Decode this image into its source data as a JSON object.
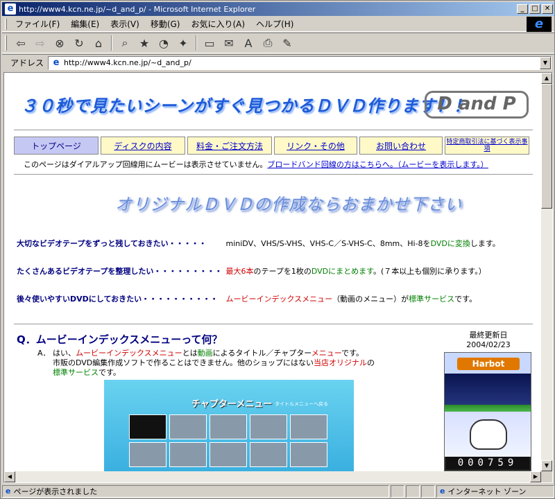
{
  "window": {
    "title": "http://www4.kcn.ne.jp/~d_and_p/ - Microsoft Internet Explorer"
  },
  "menu": [
    "ファイル(F)",
    "編集(E)",
    "表示(V)",
    "移動(G)",
    "お気に入り(A)",
    "ヘルプ(H)"
  ],
  "toolbar": {
    "icons": [
      "back-icon",
      "forward-icon",
      "stop-icon",
      "refresh-icon",
      "home-icon",
      "search-icon",
      "favorites-icon",
      "history-icon",
      "channels-icon",
      "fullscreen-icon",
      "mail-icon",
      "font-icon",
      "print-icon",
      "edit-icon"
    ]
  },
  "address": {
    "label": "アドレス",
    "url": "http://www4.kcn.ne.jp/~d_and_p/"
  },
  "page": {
    "banner": "３０秒で見たいシーンがすぐ見つかるＤＶＤ作ります！！",
    "logo": "D and P",
    "nav": [
      "トップページ",
      "ディスクの内容",
      "料金・ご注文方法",
      "リンク・その他",
      "お問い合わせ",
      "特定商取引法に基づく表示事項"
    ],
    "notice": {
      "text": "このページはダイアルアップ回線用にムービーは表示させていません。",
      "link": "ブロードバンド回線の方はこちらへ。（ムービーを表示します。）"
    },
    "headline": "オリジナルＤＶＤの作成ならおまかせ下さい",
    "services": [
      {
        "q": "大切なビデオテープをずっと残しておきたい・・・・・",
        "a1": "miniDV、VHS/S-VHS、VHS-C／S-VHS-C、8mm、Hi-8を",
        "a2": "DVDに変換",
        "a3": "します。"
      },
      {
        "q": "たくさんあるビデオテープを整理したい・・・・・・・・・",
        "a1": "最大6本",
        "a2": "のテープを1枚の",
        "a3": "DVDにまとめます",
        "a4": "。(７本以上も個別に承ります。）"
      },
      {
        "q": "後々使いやすいDVDにしておきたい・・・・・・・・・・",
        "a1": "ムービーインデックスメニュー",
        "a2": "（動画のメニュー）が",
        "a3": "標準サービス",
        "a4": "です。"
      }
    ],
    "faq": {
      "question": "Q．ムービーインデックスメニューって何？",
      "answer_prefix": "A．",
      "l1a": "はい、",
      "l1b": "ムービーインデックスメニュー",
      "l1c": "とは",
      "l1d": "動画",
      "l1e": "によるタイトル／チャプター",
      "l1f": "メニュー",
      "l1g": "です。",
      "l2a": "市販のDVD編集作成ソフトで作ることはできません。他のショップにはない",
      "l2b": "当店オリジナル",
      "l2c": "の",
      "l3a": "標準サービス",
      "l3b": "です。"
    },
    "menu_image": {
      "title": "チャプターメニュー",
      "subtitle": "タイトルメニューへ戻る"
    },
    "updated": {
      "label": "最終更新日",
      "date": "2004/02/23"
    },
    "counter": {
      "brand": "Harbot",
      "digits": "000759"
    }
  },
  "status": {
    "text": "ページが表示されました",
    "zone": "インターネット ゾーン"
  }
}
